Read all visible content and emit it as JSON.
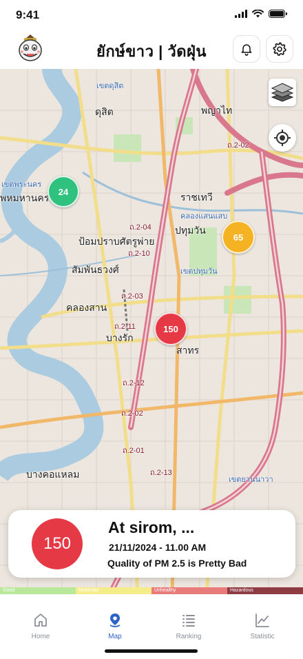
{
  "status_bar": {
    "time": "9:41"
  },
  "header": {
    "title": "ยักษ์ขาว | วัดฝุ่น",
    "icons": {
      "logo": "giant-mascot-logo",
      "notifications": "bell-icon",
      "settings": "gear-icon"
    }
  },
  "map": {
    "labels": {
      "dusit": "ดุสิต",
      "phaya_thai": "พญาไท",
      "ratchathewi": "ราชเทวี",
      "pathum_wan": "ปทุมวัน",
      "pom_prap": "ป้อมปราบศัตรูพ่าย",
      "samphanthawong": "สัมพันธวงศ์",
      "khlong_san": "คลองสาน",
      "bang_rak": "บางรัก",
      "sathorn": "สาทร",
      "bang_kho_laem": "บางคอแหลม",
      "phra_nakhon": "พหมหานคร",
      "khet_pathum_wan": "เขตปทุมวัน",
      "khet_dusit": "เขตดุสิต",
      "khet_yannawa": "เขตยานนาวา",
      "khet_phra_nakhon": "เขตพระนคร",
      "klong_saen_saeb": "คลองแสนแสบ"
    },
    "road_codes": [
      "ถ.2-04",
      "ถ.2-10",
      "ถ.2-03",
      "ถ.2-11",
      "ถ.2-12",
      "ถ.2-02",
      "ถ.2-01",
      "ถ.2-13",
      "ถ.2-02"
    ],
    "markers": [
      {
        "value": "24",
        "color": "#2ec27e"
      },
      {
        "value": "65",
        "color": "#f5b324"
      },
      {
        "value": "150",
        "color": "#e63946"
      }
    ],
    "controls": {
      "layers": "layers-icon",
      "locate": "crosshair-icon"
    }
  },
  "info_card": {
    "aqi": "150",
    "aqi_color": "#e63946",
    "station": "At sirom, ...",
    "datetime": "21/11/2024 - 11.00 AM",
    "quality": "Quality of PM 2.5 is Pretty Bad"
  },
  "legend": [
    {
      "label": "Good",
      "color": "#b9e89a"
    },
    {
      "label": "Moderate",
      "color": "#f5ec8a"
    },
    {
      "label": "Unhealthy",
      "color": "#e97b7b"
    },
    {
      "label": "Hazardous",
      "color": "#8e3b44"
    }
  ],
  "tabs": [
    {
      "label": "Home",
      "icon": "home-icon",
      "active": false
    },
    {
      "label": "Map",
      "icon": "map-pin-icon",
      "active": true
    },
    {
      "label": "Ranking",
      "icon": "list-icon",
      "active": false
    },
    {
      "label": "Statistic",
      "icon": "chart-icon",
      "active": false
    }
  ],
  "colors": {
    "accent": "#2b63c9",
    "road_major": "#d9788c",
    "water": "#aacbe0",
    "park": "#c8e6b8"
  }
}
